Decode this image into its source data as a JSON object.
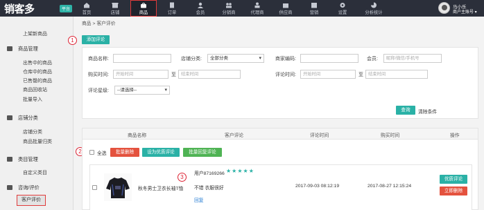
{
  "brand": {
    "logo_text": "销客多",
    "tag": "平台"
  },
  "nav": [
    {
      "label": "首页",
      "icon": "home-icon"
    },
    {
      "label": "店铺",
      "icon": "store-icon"
    },
    {
      "label": "商品",
      "icon": "bag-icon",
      "active": true
    },
    {
      "label": "订单",
      "icon": "order-icon"
    },
    {
      "label": "会员",
      "icon": "member-icon"
    },
    {
      "label": "分销商",
      "icon": "distributor-icon"
    },
    {
      "label": "代理商",
      "icon": "agent-icon"
    },
    {
      "label": "供应商",
      "icon": "supplier-icon"
    },
    {
      "label": "营销",
      "icon": "marketing-icon"
    },
    {
      "label": "设置",
      "icon": "gear-icon"
    },
    {
      "label": "分析统计",
      "icon": "chart-icon"
    }
  ],
  "user": {
    "name": "马小乐",
    "role": "商户主账号 ▾"
  },
  "sidebar": {
    "top_item": "上架新商品",
    "groups": [
      {
        "title": "商品管理",
        "items": [
          "出售中的商品",
          "仓库中的商品",
          "已售罄的商品",
          "商品回收站",
          "批量导入"
        ]
      },
      {
        "title": "店铺分类",
        "items": [
          "店铺分类",
          "商品批量归类"
        ]
      },
      {
        "title": "类目管理",
        "items": [
          "自定义类目"
        ]
      },
      {
        "title": "咨询/评价",
        "items": [
          "客户评价"
        ]
      }
    ],
    "active_item": "客户评价"
  },
  "breadcrumb": "商品 > 客户评价",
  "annotations": [
    "1",
    "2",
    "3"
  ],
  "add_button": "添加评论",
  "filters": {
    "product_name": "商品名称:",
    "store_category": "店铺分类:",
    "store_category_value": "全部分类",
    "merchant_code": "商家编码:",
    "member": "会员:",
    "member_placeholder": "昵称/微信/手机号",
    "buy_time": "购买时间:",
    "start_placeholder": "开始时间",
    "to": "至",
    "end_placeholder": "结束时间",
    "review_time": "评论时间:",
    "review_level": "评论星级:",
    "review_level_value": "--请选择--",
    "search_button": "查询",
    "clear_link": "清除条件"
  },
  "table": {
    "headers": [
      "商品名称",
      "客户评论",
      "评论时间",
      "购买时间",
      "操作"
    ],
    "select_all": "全选",
    "bulk_actions": [
      "批量删除",
      "设为优质评论",
      "批量回复评论"
    ],
    "rows": [
      {
        "product": "秋冬男士卫衣长袖T恤",
        "user": "用户87169266",
        "stars": 5,
        "comment": "不错 衣服很好",
        "reply": "回复",
        "review_time": "2017-09-03 08:12:19",
        "buy_time": "2017-08-27 12:15:24",
        "actions": [
          "优质评论",
          "立即删除"
        ]
      }
    ]
  },
  "colors": {
    "teal": "#2ab1a6",
    "red": "#e4523e",
    "green": "#4fb354",
    "nav_bg": "#2b2f3a"
  }
}
